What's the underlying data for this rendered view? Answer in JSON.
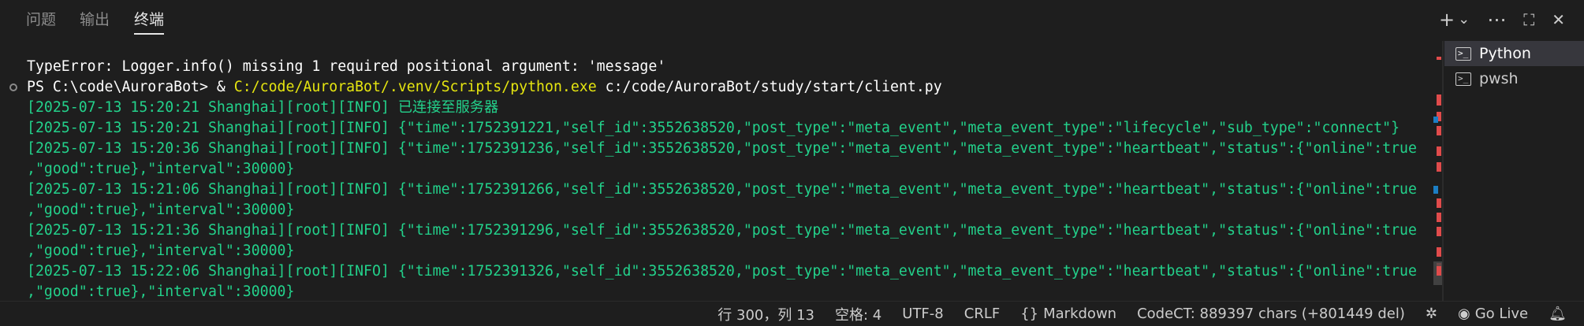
{
  "tabs": [
    {
      "label": "问题",
      "active": false
    },
    {
      "label": "输出",
      "active": false
    },
    {
      "label": "终端",
      "active": true
    }
  ],
  "panel_actions": [
    {
      "name": "new-terminal-icon",
      "glyph": "+"
    },
    {
      "name": "dropdown-icon",
      "glyph": "⌄"
    },
    {
      "name": "more-icon",
      "glyph": "⋯"
    },
    {
      "name": "maximize-icon",
      "glyph": "⛶"
    },
    {
      "name": "close-icon",
      "glyph": "✕"
    }
  ],
  "terminal": {
    "lines": [
      {
        "type": "err",
        "text": "TypeError: Logger.info() missing 1 required positional argument: 'message'"
      },
      {
        "type": "ps",
        "prefix": "PS C:\\code\\AuroraBot> & ",
        "path": "C:/code/AuroraBot/.venv/Scripts/python.exe",
        "suffix": " c:/code/AuroraBot/study/start/client.py"
      },
      {
        "type": "log",
        "text": "[2025-07-13 15:20:21 Shanghai][root][INFO] 已连接至服务器"
      },
      {
        "type": "log",
        "text": "[2025-07-13 15:20:21 Shanghai][root][INFO] {\"time\":1752391221,\"self_id\":3552638520,\"post_type\":\"meta_event\",\"meta_event_type\":\"lifecycle\",\"sub_type\":\"connect\"}"
      },
      {
        "type": "log",
        "text": "[2025-07-13 15:20:36 Shanghai][root][INFO] {\"time\":1752391236,\"self_id\":3552638520,\"post_type\":\"meta_event\",\"meta_event_type\":\"heartbeat\",\"status\":{\"online\":true"
      },
      {
        "type": "log",
        "text": ",\"good\":true},\"interval\":30000}"
      },
      {
        "type": "log",
        "text": "[2025-07-13 15:21:06 Shanghai][root][INFO] {\"time\":1752391266,\"self_id\":3552638520,\"post_type\":\"meta_event\",\"meta_event_type\":\"heartbeat\",\"status\":{\"online\":true"
      },
      {
        "type": "log",
        "text": ",\"good\":true},\"interval\":30000}"
      },
      {
        "type": "log",
        "text": "[2025-07-13 15:21:36 Shanghai][root][INFO] {\"time\":1752391296,\"self_id\":3552638520,\"post_type\":\"meta_event\",\"meta_event_type\":\"heartbeat\",\"status\":{\"online\":true"
      },
      {
        "type": "log",
        "text": ",\"good\":true},\"interval\":30000}"
      },
      {
        "type": "log",
        "text": "[2025-07-13 15:22:06 Shanghai][root][INFO] {\"time\":1752391326,\"self_id\":3552638520,\"post_type\":\"meta_event\",\"meta_event_type\":\"heartbeat\",\"status\":{\"online\":true"
      },
      {
        "type": "log",
        "text": ",\"good\":true},\"interval\":30000}"
      }
    ]
  },
  "terminal_list": [
    {
      "label": "Python",
      "selected": true
    },
    {
      "label": "pwsh",
      "selected": false
    }
  ],
  "status_bar": {
    "position": "行 300，列 13",
    "spaces": "空格: 4",
    "encoding": "UTF-8",
    "eol": "CRLF",
    "language": "Markdown",
    "language_icon": "{}",
    "codect": "CodeCT: 889397 chars (+801449 del)",
    "go_live": "Go Live"
  },
  "colors": {
    "background": "#1e1e1e",
    "log_green": "#23d18b",
    "path_yellow": "#e5e510",
    "error_marker": "#e04b4b",
    "info_marker": "#1c7ec4"
  }
}
